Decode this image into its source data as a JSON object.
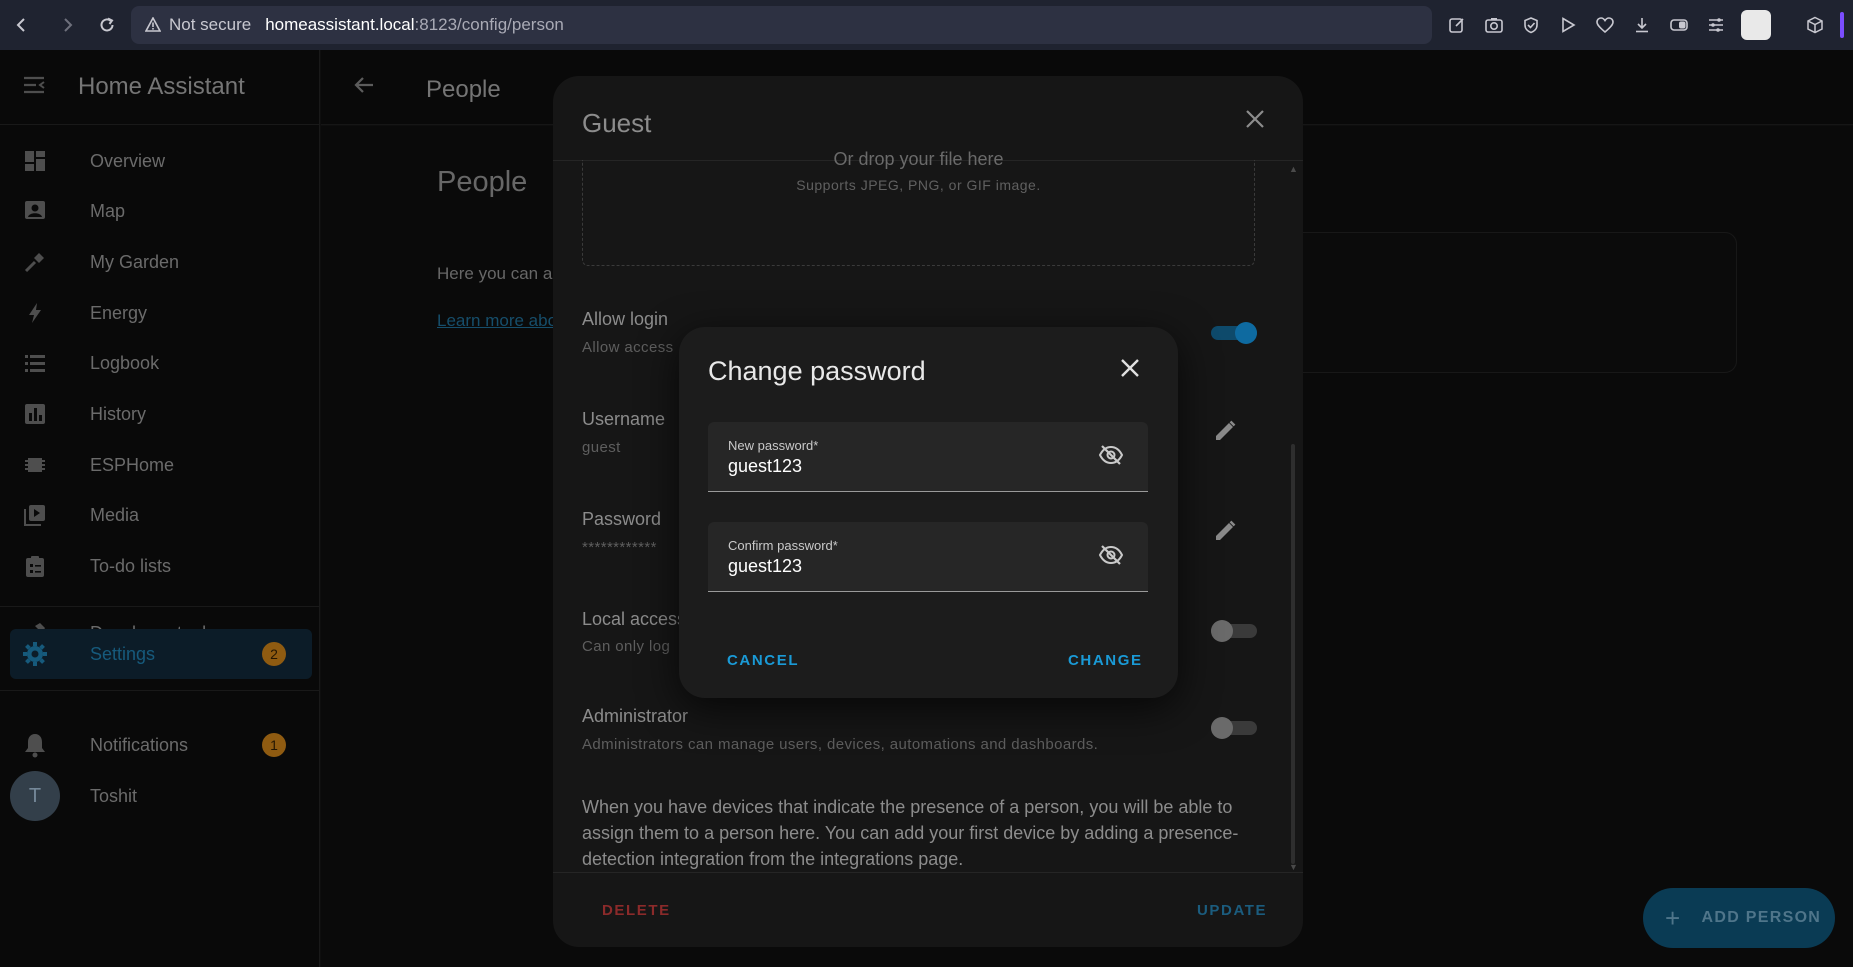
{
  "browser": {
    "security_label": "Not secure",
    "url_host": "homeassistant.local",
    "url_path": ":8123/config/person"
  },
  "sidebar": {
    "title": "Home Assistant",
    "items": [
      {
        "label": "Overview",
        "icon": "dashboard-icon"
      },
      {
        "label": "Map",
        "icon": "map-icon"
      },
      {
        "label": "My Garden",
        "icon": "shovel-icon"
      },
      {
        "label": "Energy",
        "icon": "lightning-icon"
      },
      {
        "label": "Logbook",
        "icon": "list-icon"
      },
      {
        "label": "History",
        "icon": "chart-icon"
      },
      {
        "label": "ESPHome",
        "icon": "chip-icon"
      },
      {
        "label": "Media",
        "icon": "media-icon"
      },
      {
        "label": "To-do lists",
        "icon": "clipboard-icon"
      },
      {
        "label": "Developer tools",
        "icon": "hammer-icon"
      },
      {
        "label": "Settings",
        "icon": "gear-icon",
        "badge": "2"
      }
    ],
    "notifications": {
      "label": "Notifications",
      "badge": "1"
    },
    "user": {
      "initial": "T",
      "name": "Toshit"
    }
  },
  "header": {
    "title": "People"
  },
  "page": {
    "heading": "People",
    "description": "Here you can a",
    "learn_more": "Learn more abo",
    "add_person": "ADD PERSON"
  },
  "guest_dialog": {
    "title": "Guest",
    "drop_title": "Or drop your file here",
    "drop_sub": "Supports JPEG, PNG, or GIF image.",
    "allow_login": {
      "title": "Allow login",
      "sub": "Allow access",
      "on": true
    },
    "username": {
      "title": "Username",
      "value": "guest"
    },
    "password": {
      "title": "Password",
      "value": "************"
    },
    "local_access": {
      "title": "Local access",
      "sub": "Can only log",
      "on": false
    },
    "administrator": {
      "title": "Administrator",
      "sub": "Administrators can manage users, devices, automations and dashboards.",
      "on": false
    },
    "presence_text": "When you have devices that indicate the presence of a person, you will be able to assign them to a person here. You can add your first device by adding a presence-detection integration from the integrations page.",
    "delete_label": "DELETE",
    "update_label": "UPDATE"
  },
  "change_password": {
    "title": "Change password",
    "new_label": "New password*",
    "new_value": "guest123",
    "confirm_label": "Confirm password*",
    "confirm_value": "guest123",
    "cancel_label": "CANCEL",
    "change_label": "CHANGE"
  },
  "colors": {
    "accent": "#1a9ad6",
    "danger": "#8b2a2a",
    "badge": "#a86b14"
  }
}
